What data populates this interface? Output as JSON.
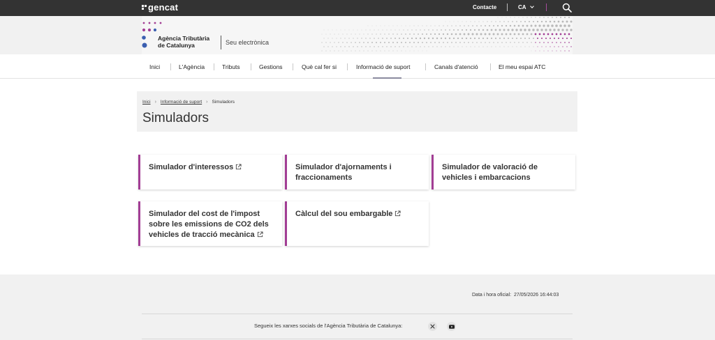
{
  "topbar": {
    "brand": "gencat",
    "contact_label": "Contacte",
    "language": "CA",
    "icons": {
      "search": "search-icon",
      "language_dropdown": "chevron-down-icon"
    }
  },
  "header": {
    "agency_line1": "Agència Tributària",
    "agency_line2": "de Catalunya",
    "site_name": "Seu electrònica"
  },
  "nav": {
    "items": [
      {
        "label": "Inici"
      },
      {
        "label": "L'Agència"
      },
      {
        "label": "Tributs"
      },
      {
        "label": "Gestions"
      },
      {
        "label": "Què cal fer si"
      },
      {
        "label": "Informació de suport",
        "active": true
      },
      {
        "label": "Canals d'atenció"
      },
      {
        "label": "El meu espai ATC"
      }
    ]
  },
  "breadcrumb": {
    "items": [
      "Inici",
      "Informació de suport",
      "Simuladors"
    ]
  },
  "page": {
    "title": "Simuladors"
  },
  "cards": [
    {
      "title": "Simulador d'interessos",
      "external": true
    },
    {
      "title": "Simulador d'ajornaments i fraccionaments",
      "external": false
    },
    {
      "title": "Simulador de valoració de vehicles i embarcacions",
      "external": false
    },
    {
      "title": "Simulador del cost de l'impost sobre les emissions de CO2 dels vehicles de tracció mecànica",
      "external": true
    },
    {
      "title": "Càlcul del sou embargable",
      "external": true
    }
  ],
  "footer": {
    "date_label": "Data i hora oficial:",
    "date_value": "27/05/2026 16:44:03",
    "social_text": "Segueix les xarxes socials de l'Agència Tributària de Catalunya:",
    "social_icons": [
      "x-icon",
      "youtube-icon"
    ]
  },
  "colors": {
    "topbar_bg": "#333333",
    "accent_purple": "#a23d94",
    "logo_blue": "#3b5fb0",
    "page_bg_grey": "#f1f1f1"
  }
}
